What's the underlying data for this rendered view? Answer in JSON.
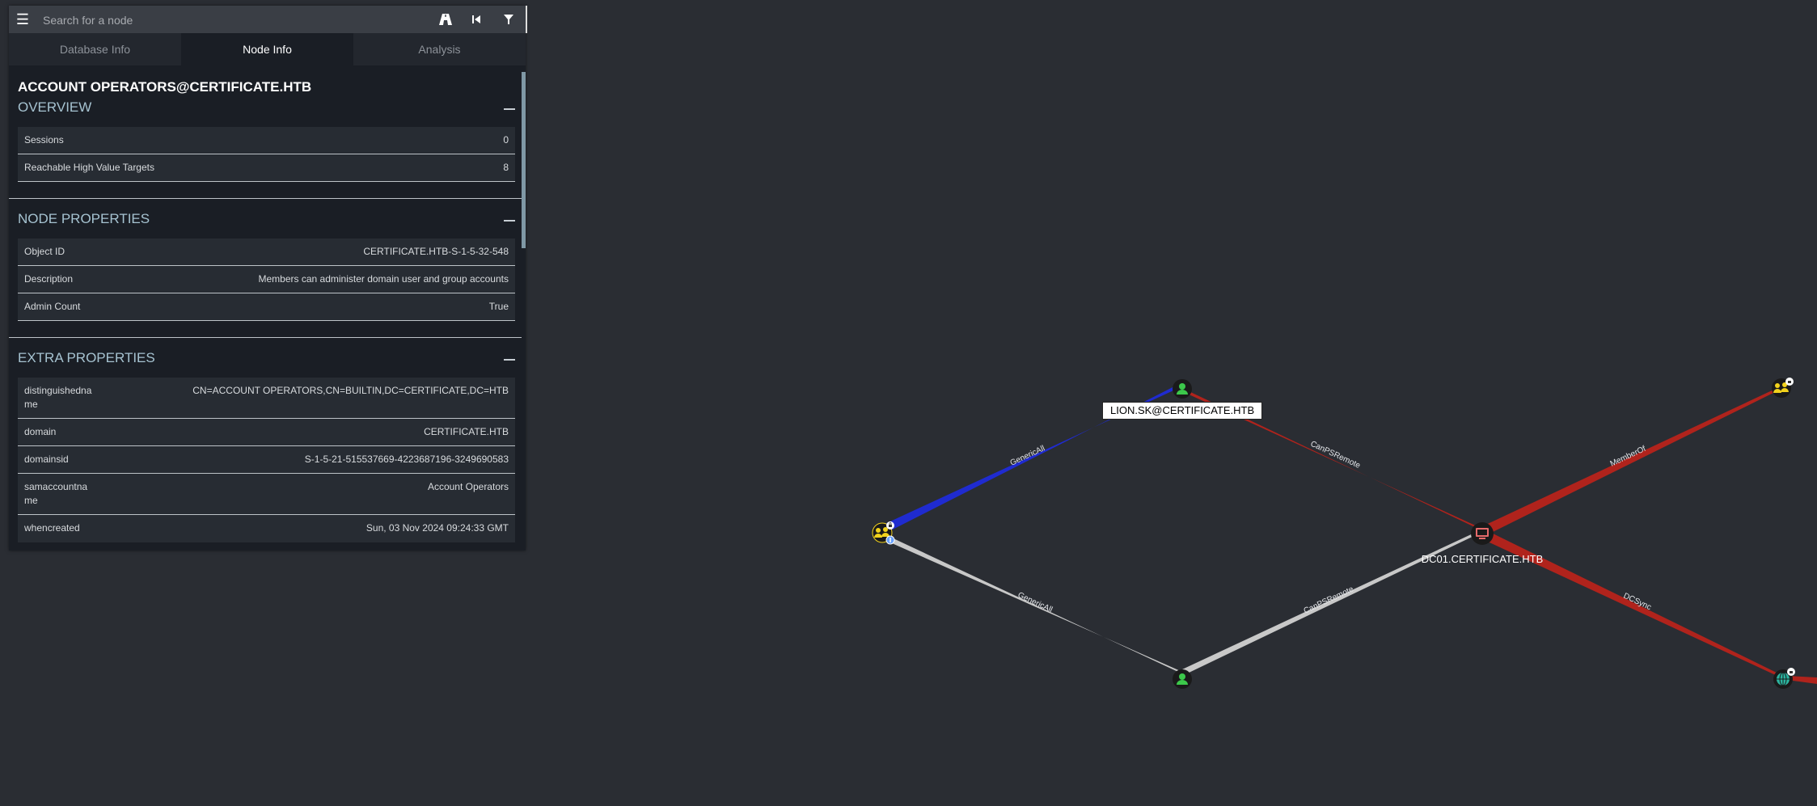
{
  "search": {
    "placeholder": "Search for a node"
  },
  "tabs": [
    {
      "label": "Database Info"
    },
    {
      "label": "Node Info"
    },
    {
      "label": "Analysis"
    }
  ],
  "active_tab": "Node Info",
  "node": {
    "title": "ACCOUNT OPERATORS@CERTIFICATE.HTB",
    "overview": {
      "heading": "OVERVIEW",
      "rows": [
        {
          "key": "Sessions",
          "value": "0"
        },
        {
          "key": "Reachable High Value Targets",
          "value": "8"
        }
      ]
    },
    "node_properties": {
      "heading": "NODE PROPERTIES",
      "rows": [
        {
          "key": "Object ID",
          "value": "CERTIFICATE.HTB-S-1-5-32-548"
        },
        {
          "key": "Description",
          "value": "Members can administer domain user and group accounts"
        },
        {
          "key": "Admin Count",
          "value": "True"
        }
      ]
    },
    "extra_properties": {
      "heading": "EXTRA PROPERTIES",
      "rows": [
        {
          "key": "distinguishedname",
          "value": "CN=ACCOUNT OPERATORS,CN=BUILTIN,DC=CERTIFICATE,DC=HTB"
        },
        {
          "key": "domain",
          "value": "CERTIFICATE.HTB"
        },
        {
          "key": "domainsid",
          "value": "S-1-5-21-515537669-4223687196-3249690583"
        },
        {
          "key": "samaccountname",
          "value": "Account Operators"
        },
        {
          "key": "whencreated",
          "value": "Sun, 03 Nov 2024 09:24:33 GMT"
        }
      ]
    }
  },
  "graph": {
    "node_labels": {
      "lion": "LION.SK@CERTIFICATE.HTB",
      "dc01": "DC01.CERTIFICATE.HTB"
    },
    "edge_labels": {
      "group_to_lion": "GenericAll",
      "group_to_user": "GenericAll",
      "lion_to_dc": "CanPSRemote",
      "user_to_dc": "CanPSRemote",
      "dc_memberof": "MemberOf",
      "dc_dcsync": "DCSync"
    },
    "colors": {
      "background": "#2a2d33",
      "edge_generic_all_blue": "#1f2bd0",
      "edge_red": "#b0231c",
      "edge_gray": "#c8c8c8",
      "user_node": "#3cc84b",
      "group_node": "#f2d21c",
      "computer_node": "#e66a6a",
      "domain_node": "#2cb5a0"
    },
    "icons": [
      "user-icon",
      "group-icon",
      "computer-icon",
      "domain-icon",
      "pwned-badge-icon",
      "high-value-badge-icon"
    ]
  }
}
